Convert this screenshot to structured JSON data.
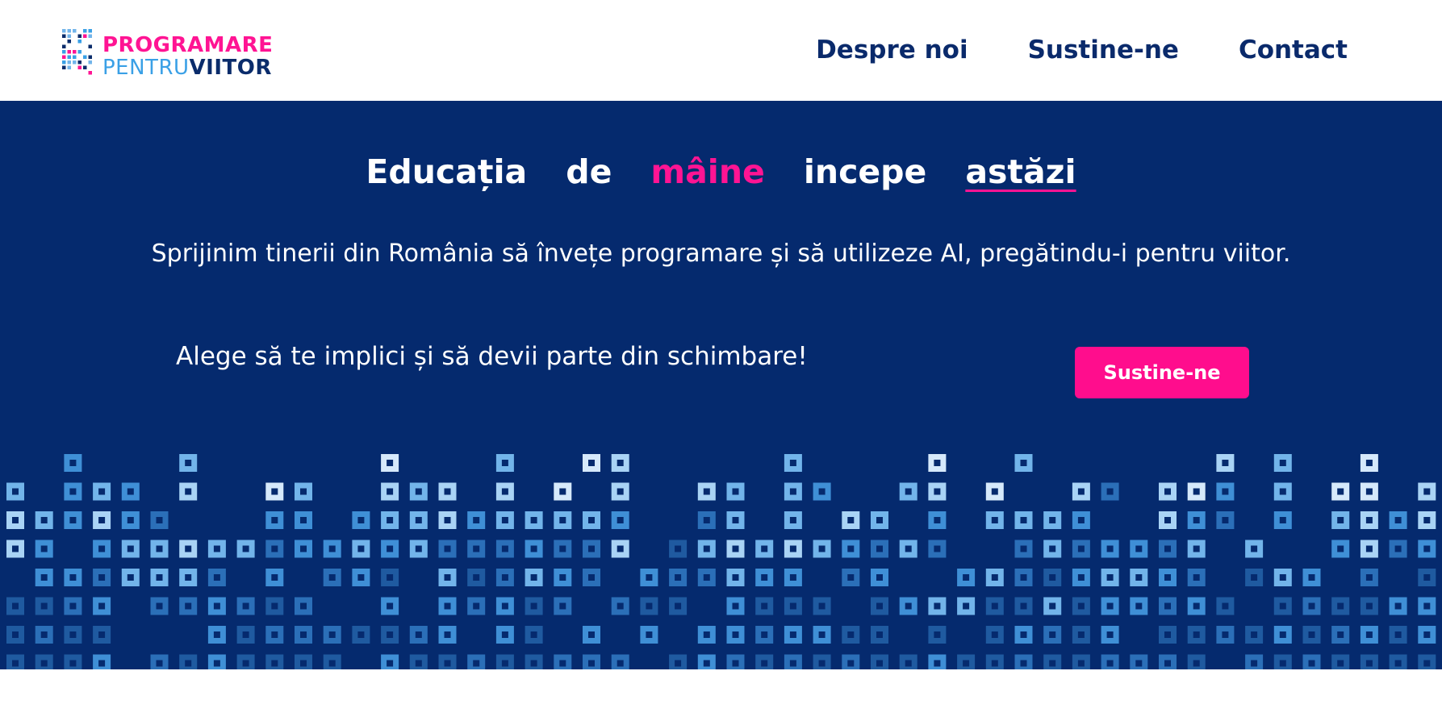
{
  "logo": {
    "line1": "PROGRAMARE",
    "line2_light": "PENTRU",
    "line2_dark": "VIITOR"
  },
  "nav": {
    "items": [
      {
        "label": "Despre noi"
      },
      {
        "label": "Sustine-ne"
      },
      {
        "label": "Contact"
      }
    ]
  },
  "hero": {
    "headline": {
      "word1": "Educația",
      "word2": "de",
      "word3": "mâine",
      "word4": "incepe",
      "word5": "astăzi"
    },
    "subtitle": "Sprijinim tinerii din România să învețe programare și să utilizeze AI, pregătindu-i pentru viitor.",
    "cta_text": "Alege să te implici și să devii parte din schimbare!",
    "cta_button": "Sustine-ne"
  },
  "colors": {
    "brand_pink": "#ff1493",
    "navy": "#052a6e",
    "nav_text": "#0a2a6b",
    "light_blue": "#3aa0e6"
  },
  "icons": {
    "logo_mark": "pixel-grid-logo-icon",
    "decoration": "pixel-squares-pattern"
  }
}
